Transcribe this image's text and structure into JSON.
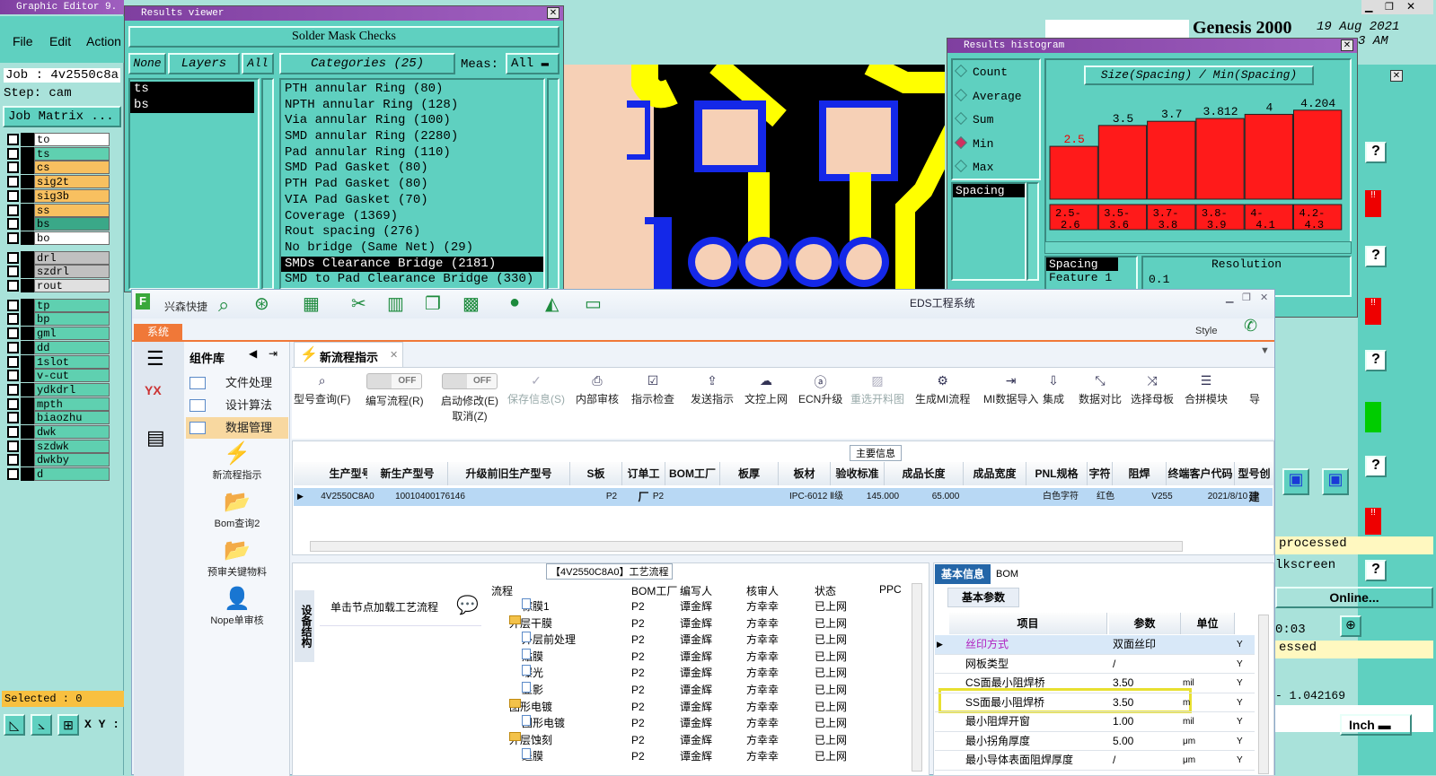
{
  "genesis_editor": {
    "title": "Graphic Editor 9.",
    "menu": [
      "File",
      "Edit",
      "Action"
    ],
    "job": "Job : 4v2550c8a",
    "step": "Step: cam",
    "job_matrix": "Job Matrix ...",
    "selected": "Selected : 0",
    "coord": "X Y :"
  },
  "layers": [
    {
      "name": "to",
      "color": "#ffffff"
    },
    {
      "name": "ts",
      "color": "#5fd0b0"
    },
    {
      "name": "cs",
      "color": "#f8c060"
    },
    {
      "name": "sig2t",
      "color": "#f8c060"
    },
    {
      "name": "sig3b",
      "color": "#f8c060"
    },
    {
      "name": "ss",
      "color": "#f8c060"
    },
    {
      "name": "bs",
      "color": "#3aa888"
    },
    {
      "name": "bo",
      "color": "#ffffff"
    },
    {
      "name": "drl",
      "color": "#c0c0c0"
    },
    {
      "name": "szdrl",
      "color": "#c0c0c0"
    },
    {
      "name": "rout",
      "color": "#e0e0e0"
    },
    {
      "name": "tp",
      "color": "#5fd0b0"
    },
    {
      "name": "bp",
      "color": "#5fd0b0"
    },
    {
      "name": "gml",
      "color": "#5fd0b0"
    },
    {
      "name": "dd",
      "color": "#5fd0b0"
    },
    {
      "name": "1slot",
      "color": "#5fd0b0"
    },
    {
      "name": "v-cut",
      "color": "#5fd0b0"
    },
    {
      "name": "ydkdrl",
      "color": "#5fd0b0"
    },
    {
      "name": "mpth",
      "color": "#5fd0b0"
    },
    {
      "name": "biaozhu",
      "color": "#5fd0b0"
    },
    {
      "name": "dwk",
      "color": "#5fd0b0"
    },
    {
      "name": "szdwk",
      "color": "#5fd0b0"
    },
    {
      "name": "dwkby",
      "color": "#5fd0b0"
    },
    {
      "name": "d",
      "color": "#5fd0b0"
    }
  ],
  "results_viewer": {
    "title": "Results viewer",
    "header": "Solder Mask Checks",
    "none_btn": "None",
    "layers_btn": "Layers",
    "all_btn": "All",
    "categories_btn": "Categories (25)",
    "meas_label": "Meas:",
    "meas_value": "All",
    "layer_list": [
      "ts",
      "bs"
    ],
    "categories": [
      "PTH annular Ring (80)",
      "NPTH annular Ring (128)",
      "Via annular Ring (100)",
      "SMD annular Ring (2280)",
      "Pad annular Ring (110)",
      "SMD Pad Gasket (80)",
      "PTH Pad Gasket (80)",
      "VIA Pad Gasket (70)",
      "Coverage (1369)",
      "Rout spacing (276)",
      "No bridge (Same Net) (29)",
      "SMDs Clearance Bridge (2181)",
      "SMD to Pad Clearance Bridge (330)"
    ],
    "selected_index": 11
  },
  "genesis_header": {
    "logo": "Genesis 2000",
    "date": "19 Aug 2021",
    "time": "3 AM"
  },
  "histogram": {
    "title": "Results histogram",
    "options": [
      "Count",
      "Average",
      "Sum",
      "Min",
      "Max"
    ],
    "selected_option": "Min",
    "chart_title": "Size(Spacing) / Min(Spacing)",
    "spacing_label": "Spacing",
    "spacing_feature": "Spacing",
    "feature_label": "Feature 1",
    "resolution_label": "Resolution",
    "resolution_value": "0.1",
    "bars": [
      {
        "value": "2.5",
        "range_lo": "2.5-",
        "range_hi": "2.6",
        "frac": 0.38,
        "highlight": true
      },
      {
        "value": "3.5",
        "range_lo": "3.5-",
        "range_hi": "3.6",
        "frac": 0.53
      },
      {
        "value": "3.7",
        "range_lo": "3.7-",
        "range_hi": "3.8",
        "frac": 0.56
      },
      {
        "value": "3.812",
        "range_lo": "3.8-",
        "range_hi": "3.9",
        "frac": 0.58
      },
      {
        "value": "4",
        "range_lo": "4-",
        "range_hi": "4.1",
        "frac": 0.61
      },
      {
        "value": "4.204",
        "range_lo": "4.2-",
        "range_hi": "4.3",
        "frac": 0.64
      }
    ]
  },
  "right_panel": {
    "processed": "processed",
    "silkscreen": "lkscreen",
    "online": "Online...",
    "time": "0:03",
    "essed": "essed",
    "value": "- 1.042169",
    "unit": "Inch"
  },
  "eds": {
    "title": "EDS工程系统",
    "brand": "兴森快捷",
    "style": "Style",
    "system_tab": "系统",
    "component_lib": "组件库",
    "side_menu": [
      {
        "label": "文件处理"
      },
      {
        "label": "设计算法"
      },
      {
        "label": "数据管理"
      }
    ],
    "side_tools": [
      "新流程指示",
      "Bom查询2",
      "预审关键物料",
      "Nope单审核"
    ],
    "doc_tab": "新流程指示",
    "toolbar": [
      {
        "label": "型号查询(F)",
        "icon": "⌕"
      },
      {
        "label": "编写流程(R)",
        "icon": "OFF"
      },
      {
        "label": "启动修改(E)",
        "icon": "OFF",
        "sub": "取消(Z)"
      },
      {
        "label": "保存信息(S)",
        "icon": "✓",
        "disabled": true
      },
      {
        "label": "内部审核",
        "icon": "⎙"
      },
      {
        "label": "指示检查",
        "icon": "☑"
      },
      {
        "label": "发送指示",
        "icon": "⇪"
      },
      {
        "label": "文控上网",
        "icon": "☁"
      },
      {
        "label": "ECN升级",
        "icon": "ⓐ"
      },
      {
        "label": "重选开料图",
        "icon": "▨",
        "disabled": true
      },
      {
        "label": "生成MI流程",
        "icon": "⚙"
      },
      {
        "label": "MI数据导入",
        "icon": "⇥"
      },
      {
        "label": "集成",
        "icon": "⇩"
      },
      {
        "label": "数据对比",
        "icon": "⤡"
      },
      {
        "label": "选择母板",
        "icon": "⤨"
      },
      {
        "label": "合拼模块",
        "icon": "☰"
      },
      {
        "label": "导",
        "icon": ""
      }
    ],
    "main_info": "主要信息",
    "grid_headers": [
      "生产型号",
      "新生产型号",
      "升级前旧生产型号",
      "S板",
      "订单工厂",
      "BOM工厂",
      "板厚",
      "板材",
      "验收标准",
      "成品长度",
      "成品宽度",
      "PNL规格",
      "字符",
      "阻焊",
      "终端客户代码",
      "型号创建"
    ],
    "grid_row": [
      "4V2550C8A0",
      "10010400176146",
      "",
      "",
      "P2",
      "P2",
      "",
      "",
      "IPC-6012 Ⅱ级",
      "145.000",
      "65.000",
      "",
      "白色字符",
      "红色",
      "V255",
      "2021/8/10"
    ],
    "flow_title": "【4V2550C8A0】工艺流程",
    "flow_side_tab": "设备结构",
    "flow_hint": "单击节点加载工艺流程",
    "flow_headers": [
      "流程",
      "BOM工厂",
      "编写人",
      "核审人",
      "状态",
      "PPC"
    ],
    "flow_rows": [
      {
        "indent": 1,
        "type": "doc",
        "name": "棕膜1",
        "factory": "P2",
        "writer": "谭金辉",
        "reviewer": "方幸幸",
        "status": "已上网"
      },
      {
        "indent": 0,
        "type": "folder",
        "name": "外层干膜",
        "factory": "P2",
        "writer": "谭金辉",
        "reviewer": "方幸幸",
        "status": "已上网"
      },
      {
        "indent": 1,
        "type": "doc",
        "name": "外层前处理",
        "factory": "P2",
        "writer": "谭金辉",
        "reviewer": "方幸幸",
        "status": "已上网"
      },
      {
        "indent": 1,
        "type": "doc",
        "name": "贴膜",
        "factory": "P2",
        "writer": "谭金辉",
        "reviewer": "方幸幸",
        "status": "已上网"
      },
      {
        "indent": 1,
        "type": "doc",
        "name": "曝光",
        "factory": "P2",
        "writer": "谭金辉",
        "reviewer": "方幸幸",
        "status": "已上网"
      },
      {
        "indent": 1,
        "type": "doc",
        "name": "显影",
        "factory": "P2",
        "writer": "谭金辉",
        "reviewer": "方幸幸",
        "status": "已上网"
      },
      {
        "indent": 0,
        "type": "folder",
        "name": "图形电镀",
        "factory": "P2",
        "writer": "谭金辉",
        "reviewer": "方幸幸",
        "status": "已上网"
      },
      {
        "indent": 1,
        "type": "doc",
        "name": "图形电镀",
        "factory": "P2",
        "writer": "谭金辉",
        "reviewer": "方幸幸",
        "status": "已上网"
      },
      {
        "indent": 0,
        "type": "folder",
        "name": "外层蚀刻",
        "factory": "P2",
        "writer": "谭金辉",
        "reviewer": "方幸幸",
        "status": "已上网"
      },
      {
        "indent": 1,
        "type": "doc",
        "name": "退膜",
        "factory": "P2",
        "writer": "谭金辉",
        "reviewer": "方幸幸",
        "status": "已上网"
      }
    ],
    "param_tabs": [
      "基本信息",
      "BOM"
    ],
    "param_subtab": "基本参数",
    "param_headers": [
      "项目",
      "参数",
      "单位"
    ],
    "params": [
      {
        "item": "丝印方式",
        "value": "双面丝印",
        "unit": "",
        "flag": "Y"
      },
      {
        "item": "网板类型",
        "value": "/",
        "unit": "",
        "flag": "Y"
      },
      {
        "item": "CS面最小阻焊桥",
        "value": "3.50",
        "unit": "mil",
        "flag": "Y"
      },
      {
        "item": "SS面最小阻焊桥",
        "value": "3.50",
        "unit": "m",
        "flag": "Y"
      },
      {
        "item": "最小阻焊开窗",
        "value": "1.00",
        "unit": "mil",
        "flag": "Y"
      },
      {
        "item": "最小拐角厚度",
        "value": "5.00",
        "unit": "μm",
        "flag": "Y"
      },
      {
        "item": "最小导体表面阻焊厚度",
        "value": "/",
        "unit": "μm",
        "flag": "Y"
      }
    ]
  }
}
